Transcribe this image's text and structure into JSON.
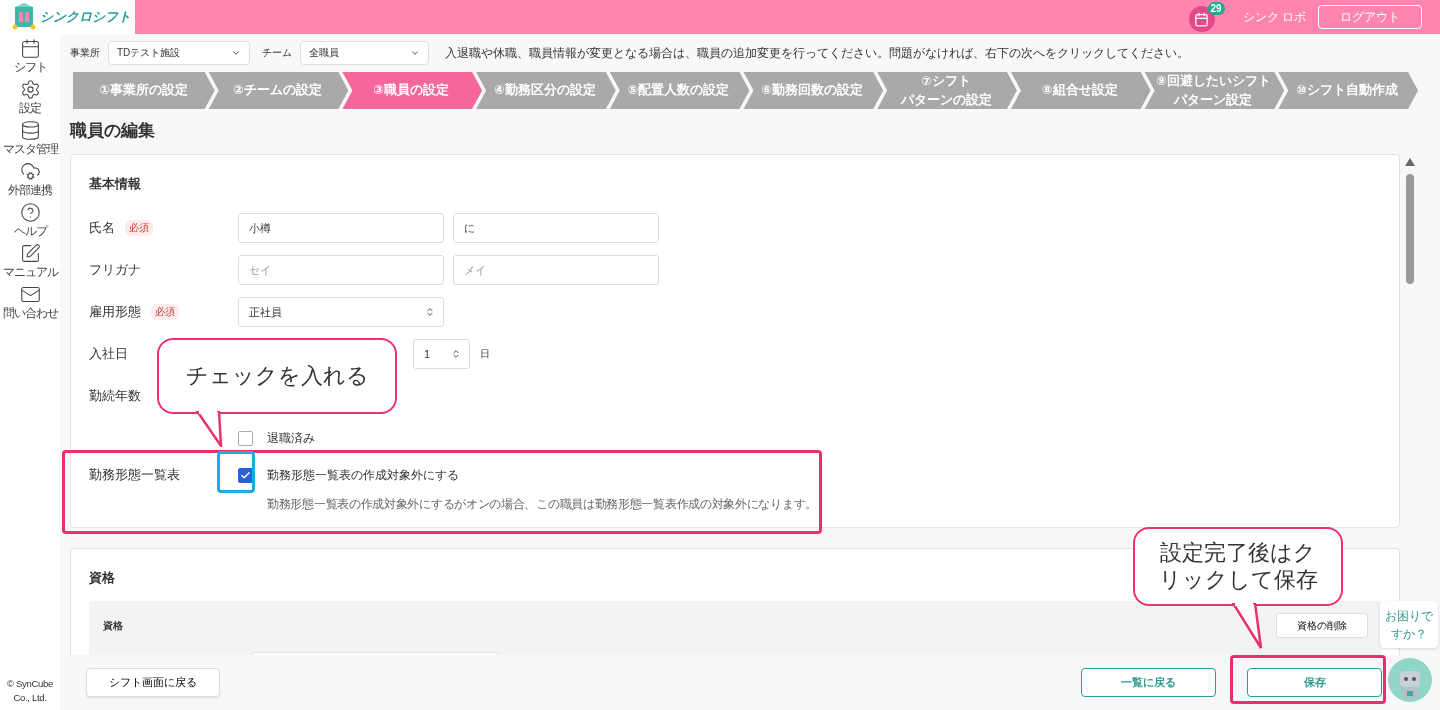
{
  "header": {
    "logo": "シンクロシフト",
    "notification_count": "29",
    "user": "シンク ロボ",
    "logout": "ログアウト"
  },
  "sidebar": {
    "items": [
      {
        "label": "シフト"
      },
      {
        "label": "設定"
      },
      {
        "label": "マスタ管理"
      },
      {
        "label": "外部連携"
      },
      {
        "label": "ヘルプ"
      },
      {
        "label": "マニュアル"
      },
      {
        "label": "問い合わせ"
      }
    ],
    "copyright": "© SynCube Co., Ltd."
  },
  "filters": [
    {
      "label": "事業所",
      "value": "TDテスト施設"
    },
    {
      "label": "チーム",
      "value": "全職員"
    }
  ],
  "notice": "入退職や休職、職員情報が変更となる場合は、職員の追加変更を行ってください。問題がなければ、右下の次へをクリックしてください。",
  "steps": [
    {
      "lines": [
        "①事業所の設定"
      ],
      "selected": false
    },
    {
      "lines": [
        "②チームの設定"
      ],
      "selected": false
    },
    {
      "lines": [
        "③職員の設定"
      ],
      "selected": true
    },
    {
      "lines": [
        "④勤務区分の設定"
      ],
      "selected": false
    },
    {
      "lines": [
        "⑤配置人数の設定"
      ],
      "selected": false
    },
    {
      "lines": [
        "⑥勤務回数の設定"
      ],
      "selected": false
    },
    {
      "lines": [
        "⑦シフト",
        "パターンの設定"
      ],
      "selected": false
    },
    {
      "lines": [
        "⑧組合せ設定"
      ],
      "selected": false
    },
    {
      "lines": [
        "⑨回避したいシフト",
        "パターン設定"
      ],
      "selected": false
    },
    {
      "lines": [
        "⑩シフト自動作成"
      ],
      "selected": false
    }
  ],
  "page_title": "職員の編集",
  "basic_info": {
    "title": "基本情報",
    "name": {
      "label": "氏名",
      "required": "必須",
      "last": "小樽",
      "first": "に"
    },
    "kana": {
      "label": "フリガナ",
      "last_placeholder": "セイ",
      "first_placeholder": "メイ"
    },
    "employment": {
      "label": "雇用形態",
      "required": "必須",
      "value": "正社員"
    },
    "hire_date": {
      "label": "入社日",
      "day": "1",
      "day_unit": "日"
    },
    "tenure": {
      "label": "勤続年数"
    },
    "retired": {
      "label": "退職済み",
      "checked": false
    },
    "work_table": {
      "label": "勤務形態一覧表",
      "option": "勤務形態一覧表の作成対象外にする",
      "checked": true,
      "description": "勤務形態一覧表の作成対象外にするがオンの場合、この職員は勤務形態一覧表作成の対象外になります。"
    }
  },
  "qualifications": {
    "title": "資格",
    "panel_title": "資格",
    "delete_button": "資格の削除"
  },
  "footer": {
    "back_to_shift": "シフト画面に戻る",
    "back_to_list": "一覧に戻る",
    "save": "保存"
  },
  "help_bubble": "お困りですか？",
  "annotations": [
    {
      "text": "チェックを入れる"
    },
    {
      "text": "設定完了後はクリックして保存"
    }
  ]
}
